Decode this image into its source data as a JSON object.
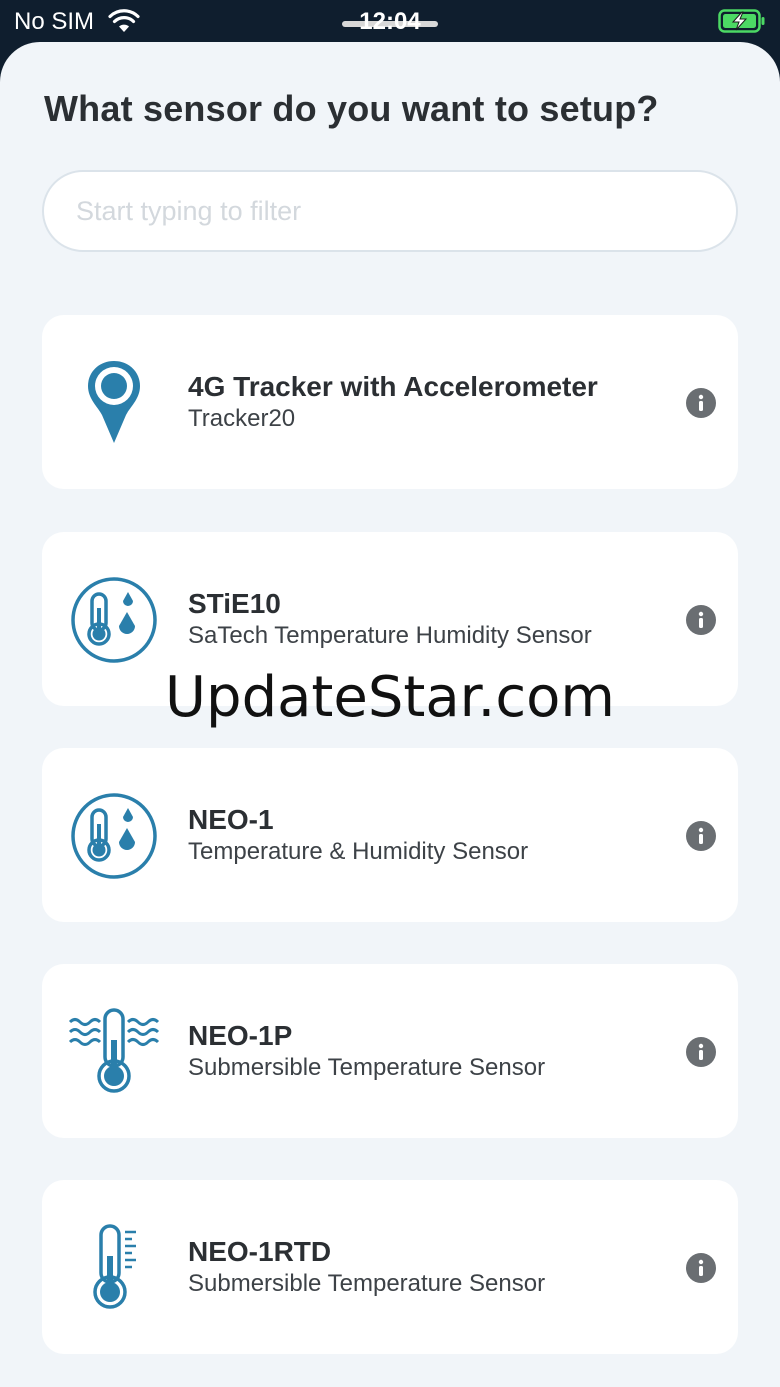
{
  "status_bar": {
    "carrier": "No SIM",
    "time": "12:04",
    "wifi_icon": "wifi-icon",
    "battery_icon": "battery-charging-icon",
    "battery_color": "#4cd964"
  },
  "page": {
    "title": "What sensor do you want to setup?"
  },
  "search": {
    "placeholder": "Start typing to filter",
    "value": ""
  },
  "sensors": [
    {
      "title": "4G Tracker with Accelerometer",
      "subtitle": "Tracker20",
      "icon": "location-pin-icon"
    },
    {
      "title": "STiE10",
      "subtitle": "SaTech Temperature Humidity Sensor",
      "icon": "thermometer-humidity-icon"
    },
    {
      "title": "NEO-1",
      "subtitle": "Temperature & Humidity Sensor",
      "icon": "thermometer-humidity-icon"
    },
    {
      "title": "NEO-1P",
      "subtitle": "Submersible Temperature Sensor",
      "icon": "submersible-thermometer-icon"
    },
    {
      "title": "NEO-1RTD",
      "subtitle": "Submersible Temperature Sensor",
      "icon": "thermometer-scale-icon"
    }
  ],
  "info_icon": "info-icon",
  "watermark": "UpdateStar.com",
  "colors": {
    "accent": "#2a7fab",
    "background": "#f1f5f9",
    "card": "#ffffff",
    "text": "#2b2f33"
  }
}
